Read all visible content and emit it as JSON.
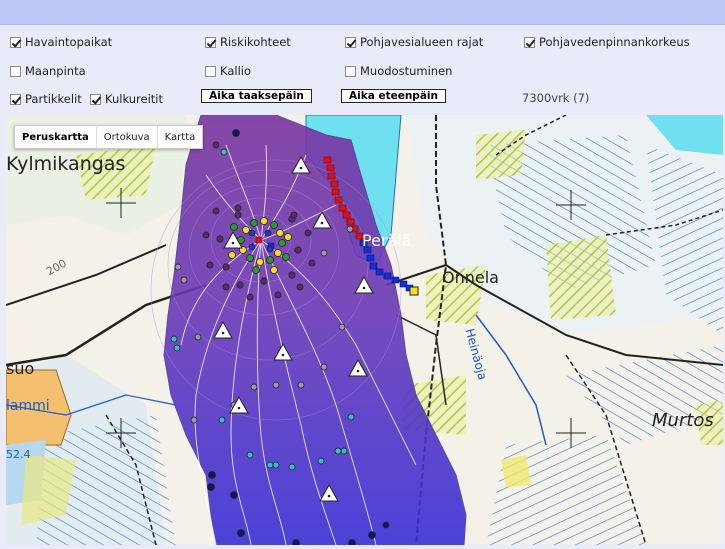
{
  "layers": {
    "havaintopaikat": {
      "label": "Havaintopaikat",
      "checked": true
    },
    "riskikohteet": {
      "label": "Riskikohteet",
      "checked": true
    },
    "pohjavesialueen_rajat": {
      "label": "Pohjavesialueen rajat",
      "checked": true
    },
    "pohjavedenpinnankorkeus": {
      "label": "Pohjavedenpinnankorkeus",
      "checked": true
    },
    "maanpinta": {
      "label": "Maanpinta",
      "checked": false
    },
    "kallio": {
      "label": "Kallio",
      "checked": false
    },
    "muodostuminen": {
      "label": "Muodostuminen",
      "checked": false
    },
    "partikkelit": {
      "label": "Partikkelit",
      "checked": true
    },
    "kulkureitit": {
      "label": "Kulkureitit",
      "checked": true
    }
  },
  "time_controls": {
    "back_label": "Aika taaksepäin",
    "forward_label": "Aika eteenpäin",
    "status": "7300vrk (7)"
  },
  "map": {
    "tabs": [
      "Peruskartta",
      "Ortokuva",
      "Kartta"
    ],
    "active_tab": "Peruskartta",
    "place_labels": {
      "kylmakangas": "Kylmikangas",
      "perala": "Perälä",
      "onnela": "Onnela",
      "heinaoja": "Heinäoja",
      "murtos": "Murtos",
      "suo": "suo",
      "lammi": "lammi",
      "elevation_200": "200",
      "elevation_52": "52.4"
    }
  },
  "colors": {
    "topbar": "#bfc9f7",
    "plume_top": "#7a3aa8",
    "plume_bottom": "#3a2fd6",
    "water": "#6fe0f0",
    "risk_red": "#e01010",
    "risk_blue": "#1030e0"
  }
}
